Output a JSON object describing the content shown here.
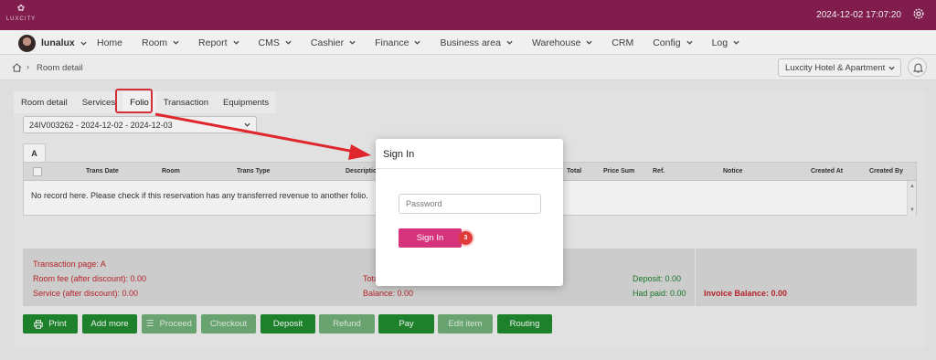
{
  "app": {
    "logo_text": "LUXCITY",
    "datetime": "2024-12-02 17:07:20",
    "brand_color": "#8a1f52",
    "accent_color": "#d6337d"
  },
  "nav": {
    "user": "lunalux",
    "items": [
      {
        "label": "Home",
        "dropdown": false
      },
      {
        "label": "Room",
        "dropdown": true
      },
      {
        "label": "Report",
        "dropdown": true
      },
      {
        "label": "CMS",
        "dropdown": true
      },
      {
        "label": "Cashier",
        "dropdown": true
      },
      {
        "label": "Finance",
        "dropdown": true
      },
      {
        "label": "Business area",
        "dropdown": true
      },
      {
        "label": "Warehouse",
        "dropdown": true
      },
      {
        "label": "CRM",
        "dropdown": false
      },
      {
        "label": "Config",
        "dropdown": true
      },
      {
        "label": "Log",
        "dropdown": true
      }
    ]
  },
  "breadcrumb": {
    "current": "Room detail"
  },
  "hotel_select": {
    "value": "Luxcity Hotel & Apartment"
  },
  "tabs": [
    "Room detail",
    "Services",
    "Folio",
    "Transaction",
    "Equipments"
  ],
  "active_tab": "Folio",
  "folio_select": {
    "value": "24IV003262 - 2024-12-02 - 2024-12-03"
  },
  "folio_subtab": "A",
  "table": {
    "columns": [
      "Trans Date",
      "Room",
      "Trans Type",
      "Description",
      "Total",
      "Price Sum",
      "Ref.",
      "Notice",
      "Created At",
      "Created By"
    ],
    "empty_message": "No record here. Please check if this reservation has any transferred revenue to another folio."
  },
  "summary": {
    "transaction_page": "Transaction page: A",
    "room_fee": "Room fee (after discount): 0.00",
    "service_fee": "Service (after discount): 0.00",
    "total_partial": "Tota",
    "balance": "Balance: 0.00",
    "deposit": "Deposit: 0.00",
    "had_paid": "Had paid: 0.00",
    "invoice_balance": "Invoice Balance: 0.00"
  },
  "buttons": {
    "print": "Print",
    "add_more": "Add more",
    "proceed": "Proceed",
    "checkout": "Checkout",
    "deposit": "Deposit",
    "refund": "Refund",
    "pay": "Pay",
    "edit_item": "Edit item",
    "routing": "Routing"
  },
  "modal": {
    "title": "Sign In",
    "password_placeholder": "Password",
    "signin_label": "Sign In",
    "step_badge": "3"
  }
}
